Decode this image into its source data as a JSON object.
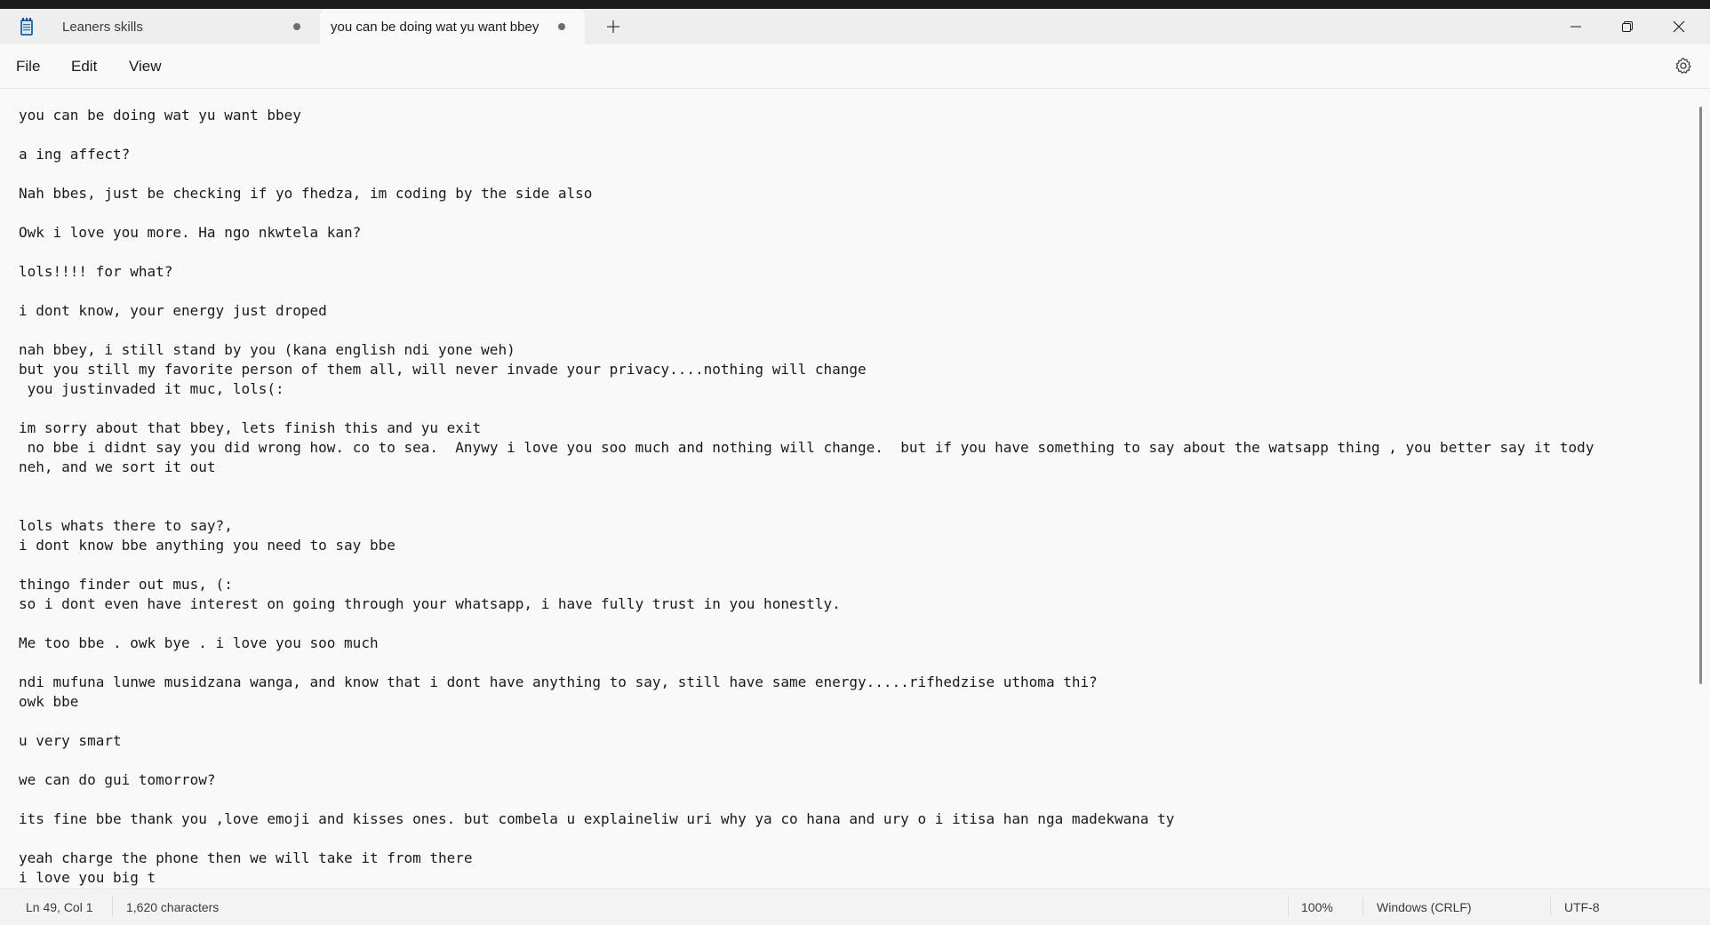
{
  "tabs": [
    {
      "label": "Leaners skills",
      "unsaved": true
    },
    {
      "label": "you can be doing wat yu want bbey",
      "unsaved": true
    }
  ],
  "menu": {
    "file": "File",
    "edit": "Edit",
    "view": "View"
  },
  "icons": {
    "app": "notepad-icon",
    "new_tab": "plus-icon",
    "minimize": "minimize-icon",
    "maximize": "restore-icon",
    "close": "close-icon",
    "settings": "gear-icon"
  },
  "editor": {
    "lines": [
      "you can be doing wat yu want bbey",
      "",
      "a ing affect?",
      "",
      "Nah bbes, just be checking if yo fhedza, im coding by the side also",
      "",
      "Owk i love you more. Ha ngo nkwtela kan?",
      "",
      "lols!!!! for what?",
      "",
      "i dont know, your energy just droped",
      "",
      "nah bbey, i still stand by you (kana english ndi yone weh)",
      "but you still my favorite person of them all, will never invade your privacy....nothing will change",
      " you justinvaded it muc, lols(:",
      "",
      "im sorry about that bbey, lets finish this and yu exit",
      " no bbe i didnt say you did wrong how. co to sea.  Anywy i love you soo much and nothing will change.  but if you have something to say about the watsapp thing , you better say it tody",
      "neh, and we sort it out",
      "",
      "",
      "lols whats there to say?,",
      "i dont know bbe anything you need to say bbe",
      "",
      "thingo finder out mus, (:",
      "so i dont even have interest on going through your whatsapp, i have fully trust in you honestly.",
      "",
      "Me too bbe . owk bye . i love you soo much",
      "",
      "ndi mufuna lunwe musidzana wanga, and know that i dont have anything to say, still have same energy.....rifhedzise uthoma thi?",
      "owk bbe",
      "",
      "u very smart",
      "",
      "we can do gui tomorrow?",
      "",
      "its fine bbe thank you ,love emoji and kisses ones. but combela u explaineliw uri why ya co hana and ury o i itisa han nga madekwana ty",
      "",
      "yeah charge the phone then we will take it from there",
      "i love you big t"
    ]
  },
  "status": {
    "position": "Ln 49, Col 1",
    "characters": "1,620 characters",
    "zoom": "100%",
    "line_ending": "Windows (CRLF)",
    "encoding": "UTF-8"
  }
}
